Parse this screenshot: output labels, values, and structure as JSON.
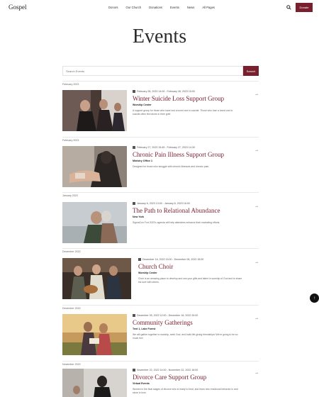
{
  "header": {
    "logo": "Gospel",
    "nav": [
      "Donors",
      "Our Church",
      "Donations",
      "Events",
      "News",
      "All Pages"
    ],
    "donate_label": "Donate"
  },
  "page": {
    "title": "Events"
  },
  "search": {
    "placeholder": "Search Events",
    "button_label": "Search"
  },
  "months": [
    "February 2023",
    "February 2023",
    "January 2023",
    "December 2022",
    "December 2022",
    "November 2022"
  ],
  "events": [
    {
      "date": "February 28, 2023 14:00 - February 28, 2023 15:00",
      "title": "Winter Suicide Loss Support Group",
      "venue": "Worship Center",
      "description": "A support group for those who have lost a loved one to suicide. Those who lose a loved one to suicide often feel alone in their grief."
    },
    {
      "date": "February 27, 2023 15:45 - February 27, 2023 14:30",
      "title": "Chronic Pain Illness Support Group",
      "venue": "Ministry Office 1",
      "description": "Designed for those who struggle with chronic illnesses and chronic pain."
    },
    {
      "date": "January 6, 2023 13:00 - January 6, 2023 16:00",
      "title": "The Path to Relational Abundance",
      "venue": "New York",
      "description": "SigmaCon Fort 2023's agenda will help attendees enhance their marketing efforts."
    },
    {
      "date": "December 16, 2022 13:00 - December 08, 2022 15:00",
      "title": "Church Choir",
      "venue": "Worship Center",
      "description": "Choir is an amazing place to develop and use your gifts and talent in worship of God and to share his love with others."
    },
    {
      "date": "December 05, 2022 12:00 - December 16, 2022 20:00",
      "title": "Community Gatherings",
      "venue": "Tent 1, Lake Forest",
      "description": "We will gather together to worship, seek God, and build life-giving friendships! We're going to be so much fun!"
    },
    {
      "date": "November 22, 2022 14:00 - November 22, 2022 16:00",
      "title": "Divorce Care Support Group",
      "venue": "Virtual Events",
      "description": "Women in the final stages of divorce who is ready to heal, and learn new emotional behavior in and since in love."
    }
  ]
}
